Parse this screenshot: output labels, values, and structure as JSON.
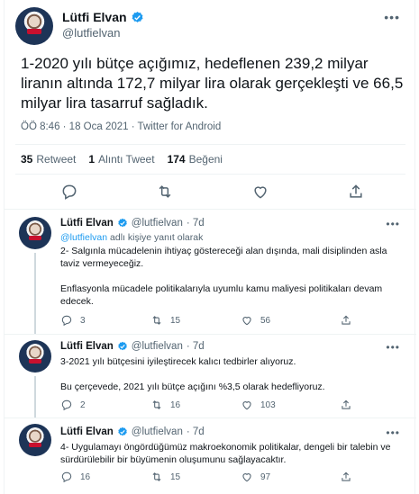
{
  "main_tweet": {
    "author_name": "Lütfi Elvan",
    "author_handle": "@lutfielvan",
    "text": "1-2020 yılı bütçe açığımız, hedeflenen 239,2 milyar liranın altında 172,7 milyar lira olarak gerçekleşti ve 66,5 milyar lira tasarruf sağladık.",
    "timestamp": "ÖÖ 8:46 · 18 Oca 2021 · Twitter for Android",
    "stats": {
      "retweets_count": "35",
      "retweets_label": "Retweet",
      "quotes_count": "1",
      "quotes_label": "Alıntı Tweet",
      "likes_count": "174",
      "likes_label": "Beğeni"
    },
    "more_label": "•••"
  },
  "replies": [
    {
      "author_name": "Lütfi Elvan",
      "author_handle": "@lutfielvan",
      "age": "· 7d",
      "reply_prefix_user": "@lutfielvan",
      "reply_prefix_text": " adlı kişiye yanıt olarak",
      "text": "2- Salgınla mücadelenin ihtiyaç göstereceği alan dışında, mali disiplinden asla taviz vermeyeceğiz.\n\nEnflasyonla mücadele politikalarıyla uyumlu kamu maliyesi politikaları devam edecek.",
      "replies_count": "3",
      "retweets_count": "15",
      "likes_count": "56",
      "more_label": "•••"
    },
    {
      "author_name": "Lütfi Elvan",
      "author_handle": "@lutfielvan",
      "age": "· 7d",
      "text": "3-2021 yılı bütçesini iyileştirecek kalıcı tedbirler alıyoruz.\n\nBu çerçevede, 2021 yılı bütçe açığını %3,5 olarak hedefliyoruz.",
      "replies_count": "2",
      "retweets_count": "16",
      "likes_count": "103",
      "more_label": "•••"
    },
    {
      "author_name": "Lütfi Elvan",
      "author_handle": "@lutfielvan",
      "age": "· 7d",
      "text": "4- Uygulamayı öngördüğümüz makroekonomik politikalar, dengeli bir talebin ve sürdürülebilir bir büyümenin oluşumunu sağlayacaktır.",
      "replies_count": "16",
      "retweets_count": "15",
      "likes_count": "97",
      "more_label": "•••"
    }
  ],
  "colors": {
    "verified": "#1d9bf0",
    "muted": "#536471",
    "link": "#1d9bf0"
  }
}
